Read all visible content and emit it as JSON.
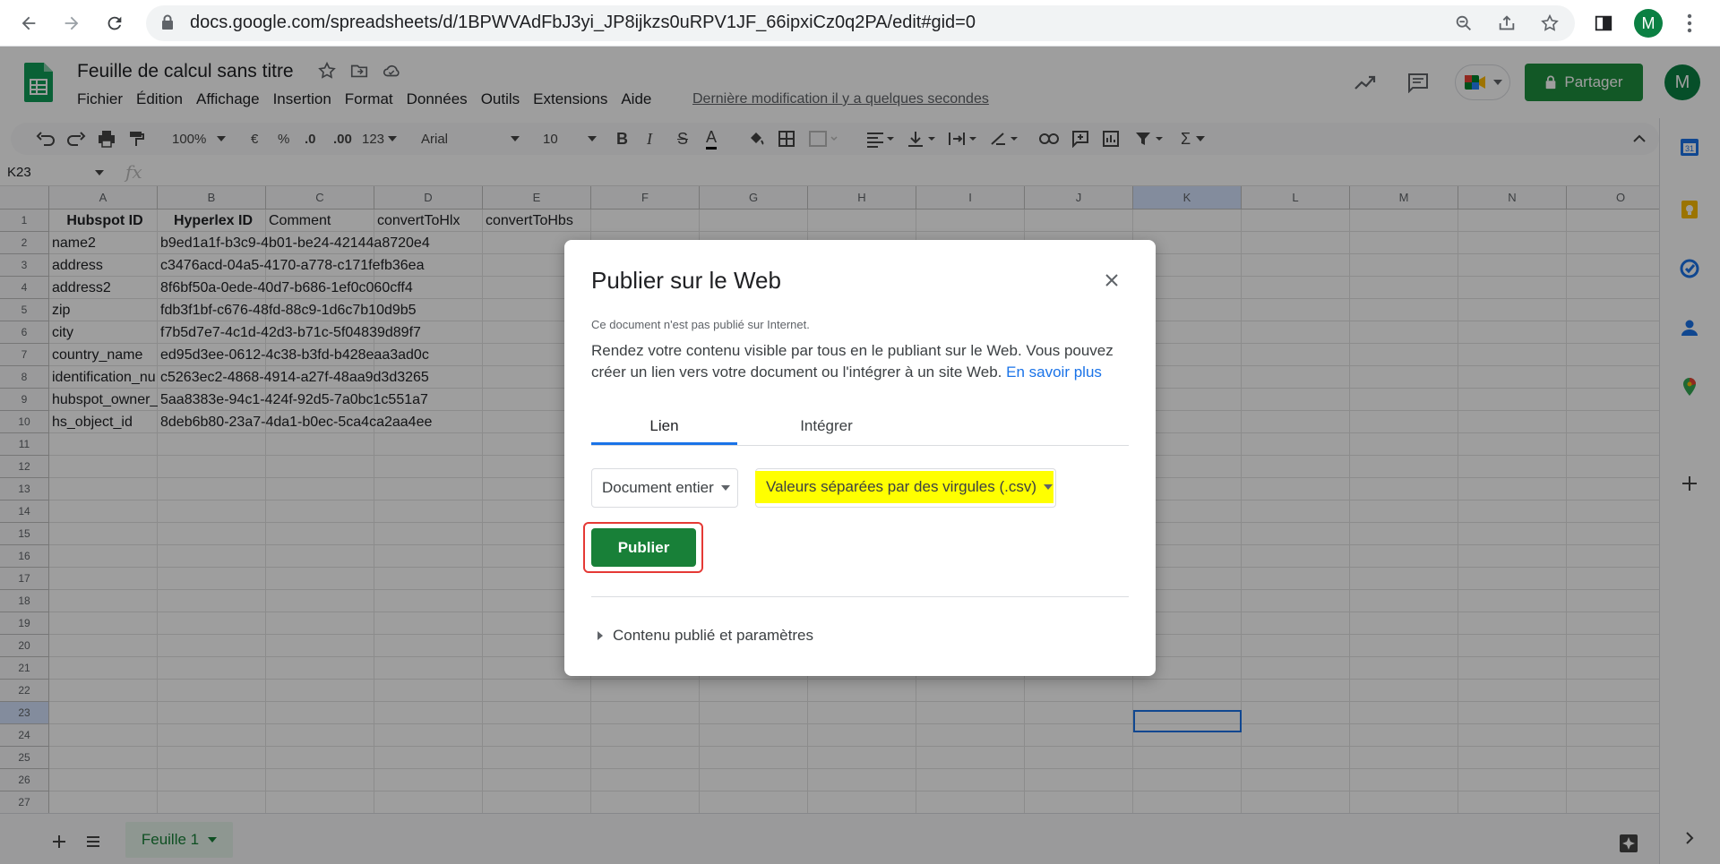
{
  "browser": {
    "url": "docs.google.com/spreadsheets/d/1BPWVAdFbJ3yi_JP8ijkzs0uRPV1JF_66ipxiCz0q2PA/edit#gid=0",
    "profile_initial": "M"
  },
  "app": {
    "title": "Feuille de calcul sans titre",
    "menu": [
      "Fichier",
      "Édition",
      "Affichage",
      "Insertion",
      "Format",
      "Données",
      "Outils",
      "Extensions",
      "Aide"
    ],
    "last_edit": "Dernière modification il y a quelques secondes",
    "share_label": "Partager",
    "avatar_initial": "M"
  },
  "toolbar": {
    "zoom": "100%",
    "currency": "€",
    "percent": "%",
    "dec_less": ".0",
    "dec_more": ".00",
    "num_format": "123",
    "font": "Arial",
    "font_size": "10",
    "bold": "B",
    "italic": "I",
    "strike": "S",
    "text_color": "A",
    "sum": "Σ"
  },
  "formula_bar": {
    "cell_ref": "K23",
    "fx": "fx"
  },
  "grid": {
    "columns": [
      "A",
      "B",
      "C",
      "D",
      "E",
      "F",
      "G",
      "H",
      "I",
      "J",
      "K",
      "L",
      "M",
      "N",
      "O"
    ],
    "rows": [
      "1",
      "2",
      "3",
      "4",
      "5",
      "6",
      "7",
      "8",
      "9",
      "10",
      "11",
      "12",
      "13",
      "14",
      "15",
      "16",
      "17",
      "18",
      "19",
      "20",
      "21",
      "22",
      "23",
      "24",
      "25",
      "26",
      "27"
    ],
    "header_row": [
      "Hubspot ID",
      "Hyperlex ID",
      "Comment",
      "convertToHlx",
      "convertToHbs"
    ],
    "data": [
      [
        "name2",
        "b9ed1a1f-b3c9-4b01-be24-42144a8720e4"
      ],
      [
        "address",
        "c3476acd-04a5-4170-a778-c171fefb36ea"
      ],
      [
        "address2",
        "8f6bf50a-0ede-40d7-b686-1ef0c060cff4"
      ],
      [
        "zip",
        "fdb3f1bf-c676-48fd-88c9-1d6c7b10d9b5"
      ],
      [
        "city",
        "f7b5d7e7-4c1d-42d3-b71c-5f04839d89f7"
      ],
      [
        "country_name",
        "ed95d3ee-0612-4c38-b3fd-b428eaa3ad0c"
      ],
      [
        "identification_nu",
        "c5263ec2-4868-4914-a27f-48aa9d3d3265"
      ],
      [
        "hubspot_owner_",
        "5aa8383e-94c1-424f-92d5-7a0bc1c551a7"
      ],
      [
        "hs_object_id",
        "8deb6b80-23a7-4da1-b0ec-5ca4ca2aa4ee"
      ]
    ]
  },
  "sheet_tab": "Feuille 1",
  "dialog": {
    "title": "Publier sur le Web",
    "note": "Ce document n'est pas publié sur Internet.",
    "description": "Rendez votre contenu visible par tous en le publiant sur le Web. Vous pouvez créer un lien vers votre document ou l'intégrer à un site Web.",
    "learn_more": "En savoir plus",
    "tabs": [
      "Lien",
      "Intégrer"
    ],
    "scope_select": "Document entier",
    "format_select": "Valeurs séparées par des virgules (.csv)",
    "publish_button": "Publier",
    "published_content": "Contenu publié et paramètres"
  },
  "colors": {
    "accent_green": "#188038",
    "highlight": "#ffff00",
    "outline_red": "#e53935",
    "link_blue": "#1a73e8"
  }
}
